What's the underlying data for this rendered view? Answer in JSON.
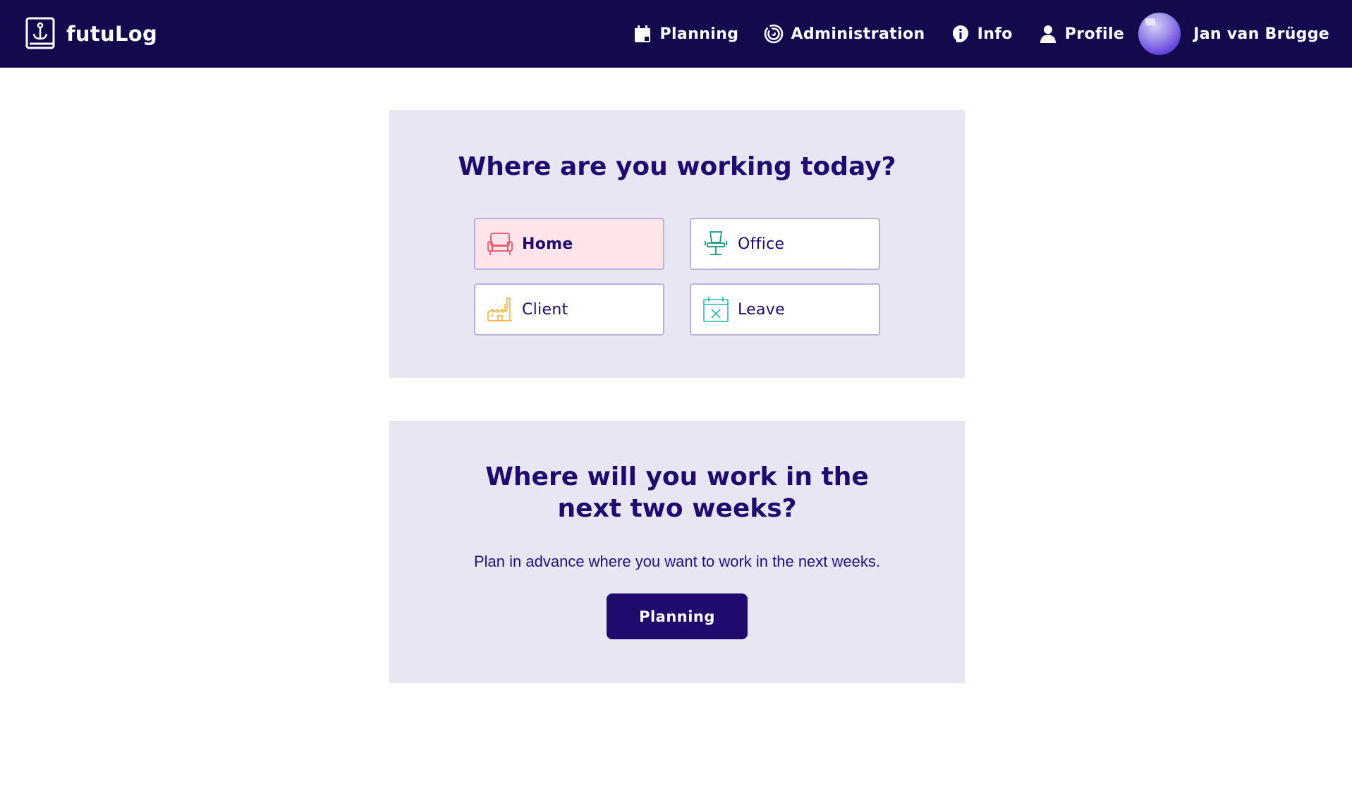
{
  "header": {
    "brand": {
      "name": "futuLog",
      "icon": "anchor-book-icon"
    },
    "nav": [
      {
        "label": "Planning",
        "icon": "calendar-icon"
      },
      {
        "label": "Administration",
        "icon": "radar-icon"
      },
      {
        "label": "Info",
        "icon": "info-icon"
      },
      {
        "label": "Profile",
        "icon": "person-icon"
      }
    ],
    "user": {
      "name": "Jan van Brügge",
      "avatar": "avatar"
    }
  },
  "today": {
    "title": "Where are you working today?",
    "selected": "Home",
    "options": [
      {
        "label": "Home",
        "icon": "armchair-icon",
        "color": "#e8536b",
        "selected": true
      },
      {
        "label": "Office",
        "icon": "office-chair-icon",
        "color": "#12987a",
        "selected": false
      },
      {
        "label": "Client",
        "icon": "factory-icon",
        "color": "#f3b13b",
        "selected": false
      },
      {
        "label": "Leave",
        "icon": "calendar-x-icon",
        "color": "#26b7b3",
        "selected": false
      }
    ]
  },
  "plan": {
    "title": "Where will you work in the next two weeks?",
    "description": "Plan in advance where you want to work in the next weeks.",
    "button_label": "Planning"
  },
  "colors": {
    "nav_bg": "#130a4e",
    "card_bg": "#e8e6f2",
    "primary": "#1f0a6e",
    "selected_bg": "#ffe5ea"
  }
}
